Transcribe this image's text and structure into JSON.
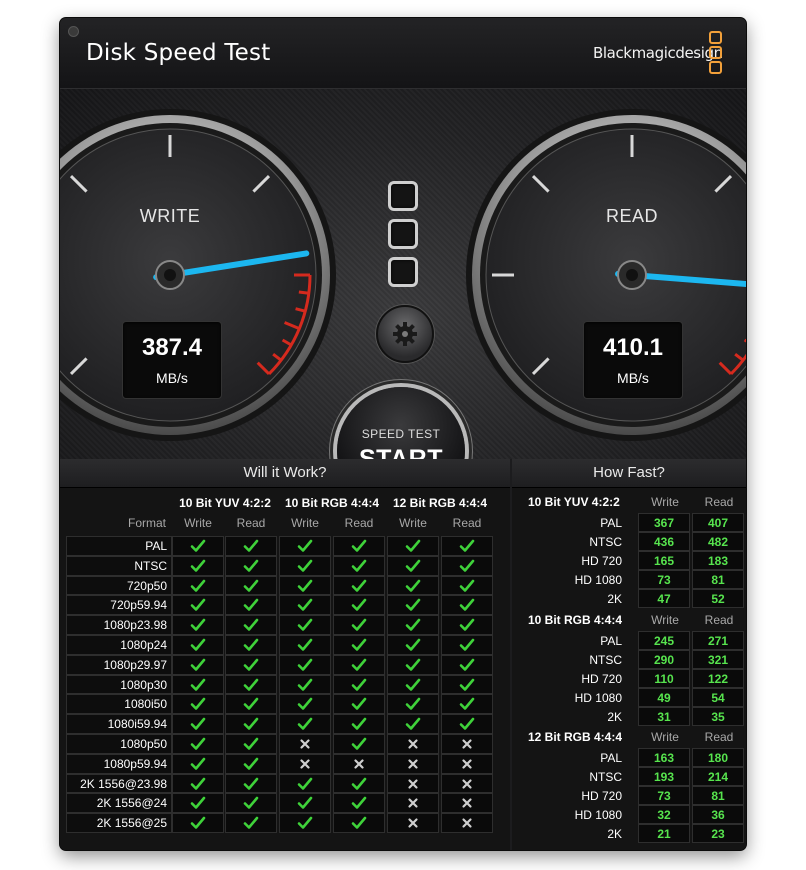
{
  "window": {
    "title": "Disk Speed Test",
    "brand": "Blackmagicdesign"
  },
  "gauges": {
    "write": {
      "label": "WRITE",
      "value": "387.4",
      "unit": "MB/s",
      "needle_fraction": 0.8
    },
    "read": {
      "label": "READ",
      "value": "410.1",
      "unit": "MB/s",
      "needle_fraction": 0.85
    }
  },
  "controls": {
    "speed_test_label": "SPEED TEST",
    "start_label": "START"
  },
  "will_it_work": {
    "title": "Will it Work?",
    "format_header": "Format",
    "groups": [
      "10 Bit YUV 4:2:2",
      "10 Bit RGB 4:4:4",
      "12 Bit RGB 4:4:4"
    ],
    "subcols": [
      "Write",
      "Read"
    ],
    "rows": [
      {
        "format": "PAL",
        "results": [
          1,
          1,
          1,
          1,
          1,
          1
        ]
      },
      {
        "format": "NTSC",
        "results": [
          1,
          1,
          1,
          1,
          1,
          1
        ]
      },
      {
        "format": "720p50",
        "results": [
          1,
          1,
          1,
          1,
          1,
          1
        ]
      },
      {
        "format": "720p59.94",
        "results": [
          1,
          1,
          1,
          1,
          1,
          1
        ]
      },
      {
        "format": "1080p23.98",
        "results": [
          1,
          1,
          1,
          1,
          1,
          1
        ]
      },
      {
        "format": "1080p24",
        "results": [
          1,
          1,
          1,
          1,
          1,
          1
        ]
      },
      {
        "format": "1080p29.97",
        "results": [
          1,
          1,
          1,
          1,
          1,
          1
        ]
      },
      {
        "format": "1080p30",
        "results": [
          1,
          1,
          1,
          1,
          1,
          1
        ]
      },
      {
        "format": "1080i50",
        "results": [
          1,
          1,
          1,
          1,
          1,
          1
        ]
      },
      {
        "format": "1080i59.94",
        "results": [
          1,
          1,
          1,
          1,
          1,
          1
        ]
      },
      {
        "format": "1080p50",
        "results": [
          1,
          1,
          0,
          1,
          0,
          0
        ]
      },
      {
        "format": "1080p59.94",
        "results": [
          1,
          1,
          0,
          0,
          0,
          0
        ]
      },
      {
        "format": "2K 1556@23.98",
        "results": [
          1,
          1,
          1,
          1,
          0,
          0
        ]
      },
      {
        "format": "2K 1556@24",
        "results": [
          1,
          1,
          1,
          1,
          0,
          0
        ]
      },
      {
        "format": "2K 1556@25",
        "results": [
          1,
          1,
          1,
          1,
          0,
          0
        ]
      }
    ]
  },
  "how_fast": {
    "title": "How Fast?",
    "cols": [
      "Write",
      "Read"
    ],
    "groups": [
      {
        "name": "10 Bit YUV 4:2:2",
        "rows": [
          {
            "label": "PAL",
            "write": "367",
            "read": "407"
          },
          {
            "label": "NTSC",
            "write": "436",
            "read": "482"
          },
          {
            "label": "HD 720",
            "write": "165",
            "read": "183"
          },
          {
            "label": "HD 1080",
            "write": "73",
            "read": "81"
          },
          {
            "label": "2K",
            "write": "47",
            "read": "52"
          }
        ]
      },
      {
        "name": "10 Bit RGB 4:4:4",
        "rows": [
          {
            "label": "PAL",
            "write": "245",
            "read": "271"
          },
          {
            "label": "NTSC",
            "write": "290",
            "read": "321"
          },
          {
            "label": "HD 720",
            "write": "110",
            "read": "122"
          },
          {
            "label": "HD 1080",
            "write": "49",
            "read": "54"
          },
          {
            "label": "2K",
            "write": "31",
            "read": "35"
          }
        ]
      },
      {
        "name": "12 Bit RGB 4:4:4",
        "rows": [
          {
            "label": "PAL",
            "write": "163",
            "read": "180"
          },
          {
            "label": "NTSC",
            "write": "193",
            "read": "214"
          },
          {
            "label": "HD 720",
            "write": "73",
            "read": "81"
          },
          {
            "label": "HD 1080",
            "write": "32",
            "read": "36"
          },
          {
            "label": "2K",
            "write": "21",
            "read": "23"
          }
        ]
      }
    ]
  },
  "colors": {
    "accent_needle": "#1cb7f0",
    "check_green": "#3fd23a",
    "value_green": "#57e44e",
    "redline": "#d52a1e",
    "brand_orange": "#f2a03a"
  }
}
